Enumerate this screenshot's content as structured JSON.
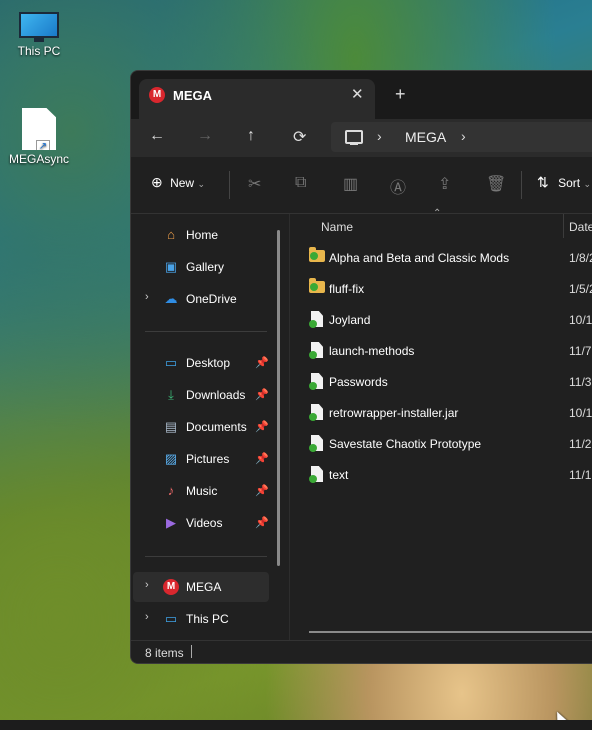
{
  "desktop": {
    "icons": [
      {
        "label": "This PC",
        "icon": "monitor-icon"
      },
      {
        "label": "MEGAsync",
        "icon": "document-shortcut-icon"
      }
    ]
  },
  "window": {
    "tab_title": "MEGA",
    "tab_close": "✕",
    "new_tab": "+",
    "nav": {
      "back": "←",
      "forward": "→",
      "up": "↑",
      "refresh": "⟳"
    },
    "address": {
      "chev1": "›",
      "location": "MEGA",
      "chev2": "›"
    },
    "toolbar": {
      "new_label": "New",
      "sort_label": "Sort"
    },
    "sidebar": {
      "items": [
        {
          "label": "Home",
          "icon": "⌂"
        },
        {
          "label": "Gallery",
          "icon": "▣"
        },
        {
          "label": "OneDrive",
          "icon": "☁"
        },
        {
          "label": "Desktop",
          "icon": "▭"
        },
        {
          "label": "Downloads",
          "icon": "⤓"
        },
        {
          "label": "Documents",
          "icon": "▤"
        },
        {
          "label": "Pictures",
          "icon": "▨"
        },
        {
          "label": "Music",
          "icon": "♪"
        },
        {
          "label": "Videos",
          "icon": "▶"
        },
        {
          "label": "MEGA",
          "icon": "M"
        },
        {
          "label": "This PC",
          "icon": "▭"
        }
      ]
    },
    "columns": {
      "name": "Name",
      "date": "Date"
    },
    "files": [
      {
        "name": "Alpha and Beta and Classic Mods",
        "date": "1/8/2",
        "type": "folder"
      },
      {
        "name": "fluff-fix",
        "date": "1/5/2",
        "type": "folder"
      },
      {
        "name": "Joyland",
        "date": "10/1",
        "type": "file"
      },
      {
        "name": "launch-methods",
        "date": "11/7",
        "type": "file"
      },
      {
        "name": "Passwords",
        "date": "11/3",
        "type": "file"
      },
      {
        "name": "retrowrapper-installer.jar",
        "date": "10/1",
        "type": "file"
      },
      {
        "name": "Savestate Chaotix Prototype",
        "date": "11/2",
        "type": "file"
      },
      {
        "name": "text",
        "date": "11/1",
        "type": "file"
      }
    ],
    "status": {
      "items": "8 items"
    }
  },
  "colors": {
    "mega_red": "#d9272e",
    "sync_green": "#3aa935",
    "folder_yellow": "#e8b64c"
  }
}
